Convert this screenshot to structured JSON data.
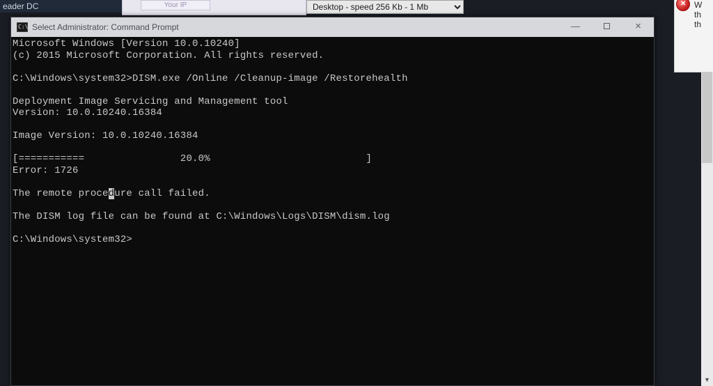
{
  "background": {
    "taskbar_fragment": "eader DC",
    "card_label": "Your IP",
    "dropdown_selected": "Desktop - speed  256 Kb - 1 Mb",
    "side_dialog_lines": [
      "W",
      "th",
      "th"
    ]
  },
  "cmd": {
    "icon_text": "C:\\",
    "title": "Select Administrator: Command Prompt",
    "controls": {
      "minimize": "—",
      "close": "×"
    },
    "lines": {
      "l0": "Microsoft Windows [Version 10.0.10240]",
      "l1": "(c) 2015 Microsoft Corporation. All rights reserved.",
      "l2": "",
      "l3": "C:\\Windows\\system32>DISM.exe /Online /Cleanup-image /Restorehealth",
      "l4": "",
      "l5": "Deployment Image Servicing and Management tool",
      "l6": "Version: 10.0.10240.16384",
      "l7": "",
      "l8": "Image Version: 10.0.10240.16384",
      "l9": "",
      "l10": "[===========                20.0%                          ]",
      "l11": "Error: 1726",
      "l12": "",
      "l13_pre": "The remote proce",
      "l13_cur": "d",
      "l13_post": "ure call failed.",
      "l14": "",
      "l15": "The DISM log file can be found at C:\\Windows\\Logs\\DISM\\dism.log",
      "l16": "",
      "l17": "C:\\Windows\\system32>"
    }
  }
}
